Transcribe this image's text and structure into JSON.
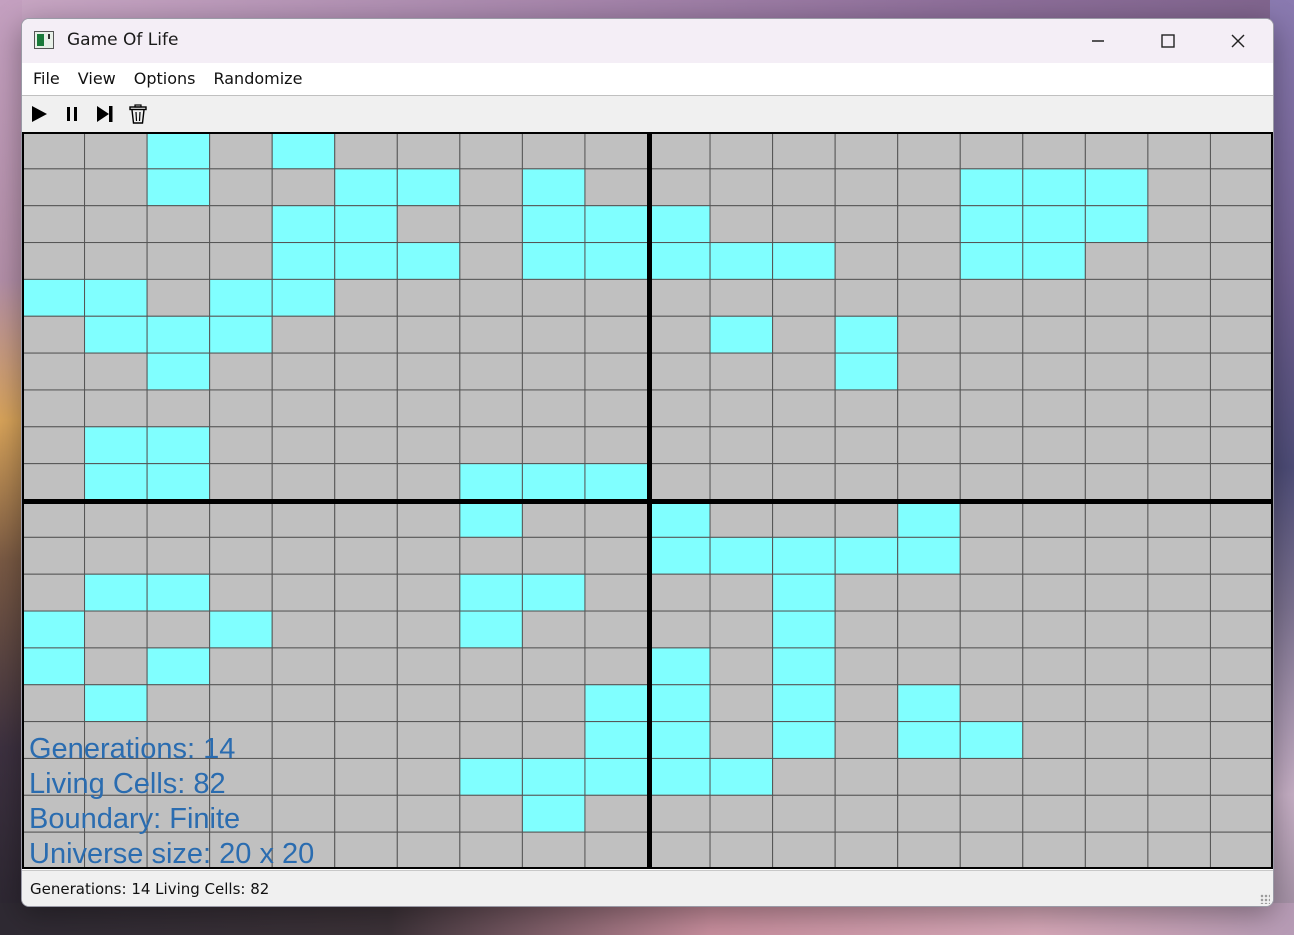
{
  "window": {
    "title": "Game Of Life"
  },
  "title_buttons": {
    "minimize": "—",
    "maximize": "☐",
    "close": "✕"
  },
  "menu": [
    "File",
    "View",
    "Options",
    "Randomize"
  ],
  "toolbar": [
    "play-icon",
    "pause-icon",
    "next-icon",
    "trash-icon"
  ],
  "colors": {
    "alive": "#80ffff",
    "dead": "#c0c0c0",
    "grid": "#555555",
    "quadrant_lines": "#000000",
    "overlay_text": "#2a6cb0"
  },
  "universe": {
    "rows": 20,
    "cols": 20,
    "live_cells": [
      [
        0,
        2
      ],
      [
        0,
        4
      ],
      [
        1,
        2
      ],
      [
        1,
        5
      ],
      [
        1,
        6
      ],
      [
        1,
        8
      ],
      [
        1,
        15
      ],
      [
        1,
        16
      ],
      [
        1,
        17
      ],
      [
        2,
        4
      ],
      [
        2,
        5
      ],
      [
        2,
        8
      ],
      [
        2,
        9
      ],
      [
        2,
        10
      ],
      [
        2,
        15
      ],
      [
        2,
        16
      ],
      [
        2,
        17
      ],
      [
        3,
        4
      ],
      [
        3,
        5
      ],
      [
        3,
        6
      ],
      [
        3,
        8
      ],
      [
        3,
        9
      ],
      [
        3,
        10
      ],
      [
        3,
        11
      ],
      [
        3,
        12
      ],
      [
        3,
        15
      ],
      [
        3,
        16
      ],
      [
        4,
        0
      ],
      [
        4,
        1
      ],
      [
        4,
        3
      ],
      [
        4,
        4
      ],
      [
        5,
        1
      ],
      [
        5,
        2
      ],
      [
        5,
        3
      ],
      [
        5,
        11
      ],
      [
        5,
        13
      ],
      [
        6,
        2
      ],
      [
        6,
        13
      ],
      [
        8,
        1
      ],
      [
        8,
        2
      ],
      [
        9,
        1
      ],
      [
        9,
        2
      ],
      [
        9,
        7
      ],
      [
        9,
        8
      ],
      [
        9,
        9
      ],
      [
        10,
        7
      ],
      [
        10,
        10
      ],
      [
        10,
        14
      ],
      [
        11,
        10
      ],
      [
        11,
        11
      ],
      [
        11,
        12
      ],
      [
        11,
        13
      ],
      [
        11,
        14
      ],
      [
        12,
        1
      ],
      [
        12,
        2
      ],
      [
        12,
        7
      ],
      [
        12,
        8
      ],
      [
        12,
        12
      ],
      [
        13,
        0
      ],
      [
        13,
        3
      ],
      [
        13,
        7
      ],
      [
        13,
        12
      ],
      [
        14,
        0
      ],
      [
        14,
        2
      ],
      [
        14,
        10
      ],
      [
        14,
        12
      ],
      [
        15,
        1
      ],
      [
        15,
        9
      ],
      [
        15,
        10
      ],
      [
        15,
        12
      ],
      [
        15,
        14
      ],
      [
        16,
        9
      ],
      [
        16,
        10
      ],
      [
        16,
        12
      ],
      [
        16,
        14
      ],
      [
        16,
        15
      ],
      [
        17,
        7
      ],
      [
        17,
        8
      ],
      [
        17,
        9
      ],
      [
        17,
        10
      ],
      [
        17,
        11
      ],
      [
        18,
        8
      ]
    ]
  },
  "overlay": {
    "generations": "Generations: 14",
    "living_cells": "Living Cells: 82",
    "boundary": "Boundary: Finite",
    "universe_size": "Universe size: 20 x 20"
  },
  "status": {
    "text": "Generations: 14 Living Cells: 82"
  }
}
